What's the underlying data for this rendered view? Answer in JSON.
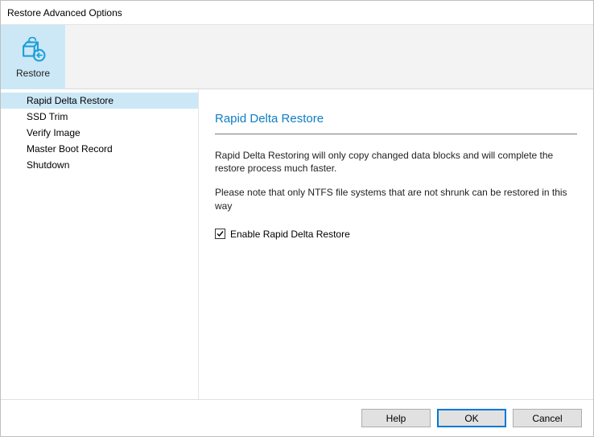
{
  "window": {
    "title": "Restore Advanced Options"
  },
  "ribbon": {
    "restore_label": "Restore"
  },
  "sidebar": {
    "items": [
      {
        "label": "Rapid Delta Restore",
        "selected": true
      },
      {
        "label": "SSD Trim",
        "selected": false
      },
      {
        "label": "Verify Image",
        "selected": false
      },
      {
        "label": "Master Boot Record",
        "selected": false
      },
      {
        "label": "Shutdown",
        "selected": false
      }
    ]
  },
  "main": {
    "heading": "Rapid Delta Restore",
    "paragraph1": "Rapid Delta Restoring will only copy changed data blocks and will complete the restore process much faster.",
    "paragraph2": "Please note that only NTFS file systems that are not shrunk can be restored in this way",
    "checkbox_label": "Enable Rapid Delta Restore",
    "checkbox_checked": true
  },
  "buttons": {
    "help": "Help",
    "ok": "OK",
    "cancel": "Cancel"
  },
  "colors": {
    "accent": "#0f7ec2",
    "highlight_bg": "#cce8f6",
    "button_border_default": "#0078d7"
  }
}
